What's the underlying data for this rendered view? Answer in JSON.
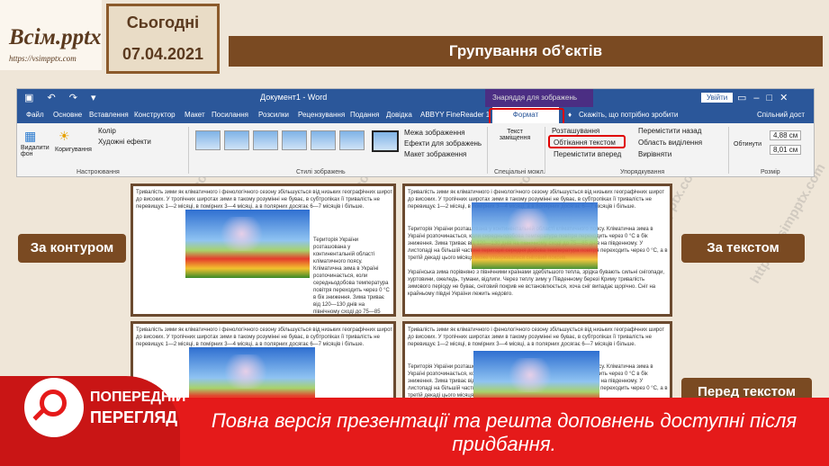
{
  "header": {
    "logo": "Всім.pptx",
    "logo_url": "https://vsimpptx.com",
    "today_label": "Сьогодні",
    "date": "07.04.2021",
    "title": "Групування об’єктів"
  },
  "word": {
    "doc_title": "Документ1 - Word",
    "context_tools": "Знаряддя для зображень",
    "signin": "Увійти",
    "tabs": [
      "Файл",
      "Основне",
      "Вставлення",
      "Конструктор",
      "Макет",
      "Посилання",
      "Розсилки",
      "Рецензування",
      "Подання",
      "Довідка",
      "ABBYY FineReader 1"
    ],
    "format_tab": "Формат",
    "tell_me": "Скажіть, що потрібно зробити",
    "shared": "Спільний дост",
    "ribbon": {
      "remove_bg": "Видалити фон",
      "corrections": "Коригування",
      "color": "Колір",
      "artistic": "Художні ефекти",
      "adjust_group": "Настроювання",
      "picture_border": "Межа зображення",
      "picture_effects": "Ефекти для зображень",
      "picture_layout": "Макет зображення",
      "styles_group": "Стилі зображень",
      "alt_text": "Текст заміщення",
      "accessibility_group": "Спеціальні можл.",
      "position": "Розташування",
      "wrap_text": "Обтікання текстом",
      "bring_forward": "Перемістити вперед",
      "send_backward": "Перемістити назад",
      "selection_pane": "Область виділення",
      "align": "Вирівняти",
      "arrange_group": "Упорядкування",
      "crop": "Обтинути",
      "height": "4,88 см",
      "width": "8,01 см",
      "size_group": "Розмір"
    }
  },
  "panels": {
    "text_a": "Тривалість зими як кліматичного і фенологічного сезону збільшується від низьких географічних широт до високих. У тропічних широтах зими в такому розумінні не буває, в субтропіках її тривалість не перевищує 1—2 місяці, в помірних 3—4 місяці, а в полярних досягає 6—7 місяців і більше.",
    "text_b": "Територія України розташована у континентальній області кліматичного поясу. Кліматична зима в Україні розпочинається, коли середньодобова температура повітря переходить через 0 °С в бік зниження. Зима триває від 120—130 днів на північному сході до 75—85 днів на південному. У листопаді на більшій частині території середня добова температура повітря переходить через 0 °С, а в третій декаді цього місяця може утворюватися сніговий покрив.",
    "text_c": "Українська зима порівняно з північними країнами здебільшого тепла, зрідка бувають сильні снігопади, хуртовини, ожеледь, тумани, відлиги. Через теплу зиму у Південному березі Криму тривалість зимового періоду не буває, сніговий покрив не встановлюється, хоча сніг випадає щорічно. Сніг на крайньому півдні України лежить недовго.",
    "labels": {
      "contour": "За контуром",
      "by_text": "За текстом",
      "before_text": "Перед текстом"
    }
  },
  "banner": {
    "preview_line1": "ПОПЕРЕДНІЙ",
    "preview_line2": "ПЕРЕГЛЯД",
    "message": "Повна версія презентації та решта доповнень доступні після придбання."
  }
}
